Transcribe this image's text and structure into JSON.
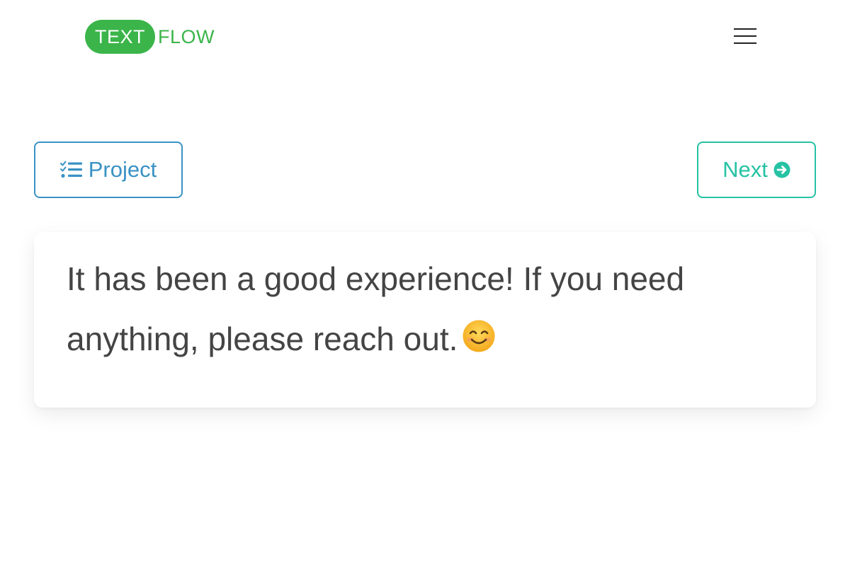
{
  "header": {
    "logo_pill": "TEXT",
    "logo_text": "FLOW",
    "menu_icon": "hamburger-menu-icon"
  },
  "nav": {
    "project_label": "Project",
    "project_icon": "task-list-icon",
    "next_label": "Next",
    "next_icon": "arrow-circle-right-icon"
  },
  "message": {
    "text": "It has been a good experience! If you need anything, please reach out.",
    "emoji": "smiling-face-emoji"
  },
  "colors": {
    "brand_green": "#3bb54a",
    "project_blue": "#3a92c4",
    "next_teal": "#26c2a4",
    "body_text": "#444444"
  }
}
